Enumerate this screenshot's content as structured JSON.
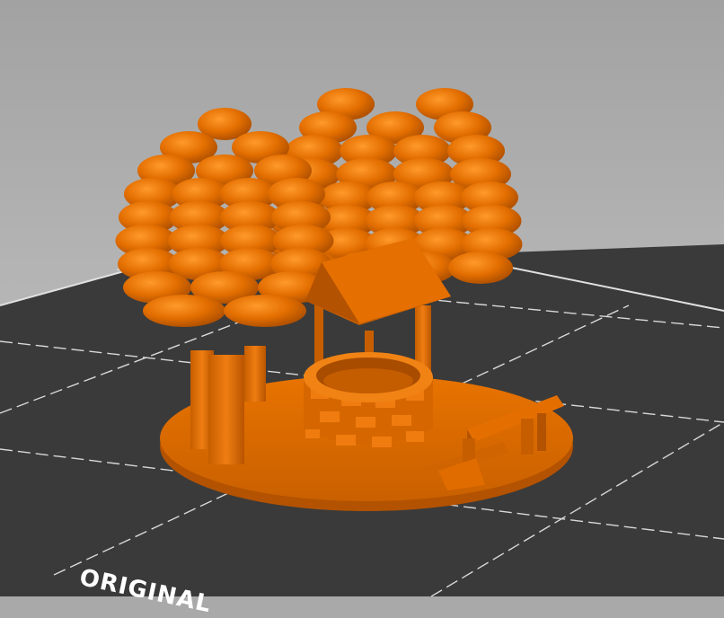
{
  "viewport": {
    "bed_label": "ORIGINAL"
  },
  "colors": {
    "background_top": "#a2a2a2",
    "bed": "#3a3a3a",
    "bed_grid": "#d8d8d8",
    "model": "#e36e00",
    "model_shadow": "#b85400",
    "model_highlight": "#ff9a2a"
  },
  "model": {
    "parts": [
      "tree-left",
      "tree-right",
      "wishing-well",
      "well-roof",
      "bench",
      "base-plate"
    ]
  }
}
